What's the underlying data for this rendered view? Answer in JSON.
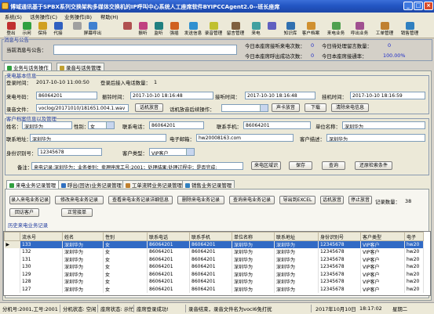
{
  "window": {
    "title": "博域通讯基于SPBX系列交换架构多媒体交换机的IP呼叫中心系统人工座席软件BYIPCCAgent2.0--班长座席",
    "min": "_",
    "max": "□",
    "close": "×"
  },
  "menu": [
    "系统(S)",
    "话务操作(C)",
    "业务操作(B)",
    "帮助(H)"
  ],
  "toolbar": [
    "登出",
    "示闲",
    "保持",
    "代接",
    "",
    "屏幕呼出",
    "",
    "振听",
    "监听",
    "强插",
    "发送信息",
    "录音管理",
    "留言管理",
    "来电",
    "",
    "知识库",
    "客户档案",
    "来电业务",
    "呼出业务",
    "工单管理",
    "销售管理"
  ],
  "notice": {
    "group_title": "消息与公告",
    "label": "当前消息与公告：",
    "stats": [
      {
        "label": "今日本座席接听来电次数：",
        "value": "0"
      },
      {
        "label": "今日本座席呼出成功次数：",
        "value": "0"
      },
      {
        "label": "今日待处理留言数量：",
        "value": "0"
      },
      {
        "label": "今日本座席接通率：",
        "value": "100.00%"
      }
    ]
  },
  "main_tabs": [
    "业务与话务操作",
    "录音与话务管理"
  ],
  "call_info": {
    "group_title": "来电基本信息",
    "login_time_label": "登录时间：",
    "login_time": "2017-10-10 11:00:50",
    "count_label": "登录后接入电话数量：",
    "count": "1",
    "caller_label": "来电号码：",
    "caller": "86064201",
    "ring_time_label": "振铃时间：",
    "ring_time": "2017-10-10 18:16:48",
    "answer_time_label": "接听时间：",
    "answer_time": "2017-10-10 18:16:48",
    "hangup_time_label": "挂机时间：",
    "hangup_time": "2017-10-10 18:16:59",
    "recfile_label": "录音文件：",
    "recfile": "voclog/20171010/181651.004.1.wav",
    "play_btn": "话机放音",
    "after_label": "话机放音后续操作：",
    "after_value": "",
    "sound_btn": "声卡放音",
    "download_btn": "下载",
    "clear_btn": "清除来电信息"
  },
  "customer": {
    "group_title": "客户档案信息以及管理",
    "name_label": "姓名：",
    "name": "深圳华为",
    "sex_label": "性别：",
    "sex": "女",
    "tel_label": "联系电话：",
    "tel": "86064201",
    "mobile_label": "联系手机：",
    "mobile": "86064201",
    "company_label": "单位名称：",
    "company": "深圳华为",
    "addr_label": "联系地址：",
    "addr": "深圳华为",
    "email_label": "电子邮箱：",
    "email": "hw20008163.com",
    "desc_label": "客户描述：",
    "desc": "深圳华为",
    "id_label": "身份识别号：",
    "id": "12345678",
    "type_label": "客户类型：",
    "type": "VIP客户",
    "note_label": "备注：",
    "note": "来电记录:深圳华为；业务类别：卖理座席工号:2001；处理结果:处理过程中；是否完成:",
    "btns": [
      "来电区域识",
      "保存",
      "查询",
      "还原检索条件"
    ]
  },
  "biz_tabs": [
    "来电业务记录管理",
    "呼出(回访)业务记录管理",
    "工单流转业务记录管理",
    "销售业务记录管理"
  ],
  "biz_buttons": [
    "录入来电业务记录",
    "修改来电业务记录",
    "查看来电业务记录详细信息",
    "删除来电业务记录",
    "查询来电业务记录",
    "导出到EXCEL",
    "话机放音",
    "停止放音"
  ],
  "biz_buttons2": [
    "回访客户",
    "正常接单"
  ],
  "record_count_label": "记录数量：",
  "record_count": "38",
  "history_title": "历史来电业务记录",
  "table": {
    "headers": [
      "流水号",
      "姓名",
      "性别",
      "联系电话",
      "联系手机",
      "单位名称",
      "联系地址",
      "身份识别号",
      "客户类型",
      "电子"
    ],
    "rows": [
      [
        "133",
        "深圳华为",
        "女",
        "86064201",
        "86064201",
        "深圳华为",
        "深圳华为",
        "12345678",
        "VIP客户",
        "hw20"
      ],
      [
        "132",
        "深圳华为",
        "女",
        "86064201",
        "86064201",
        "深圳华为",
        "深圳华为",
        "12345678",
        "VIP客户",
        "hw20"
      ],
      [
        "131",
        "深圳华为",
        "女",
        "86064201",
        "86064201",
        "深圳华为",
        "深圳华为",
        "12345678",
        "VIP客户",
        "hw20"
      ],
      [
        "130",
        "深圳华为",
        "女",
        "86064201",
        "86064201",
        "深圳华为",
        "深圳华为",
        "12345678",
        "VIP客户",
        "hw20"
      ],
      [
        "129",
        "深圳华为",
        "女",
        "86064201",
        "86064201",
        "深圳华为",
        "深圳华为",
        "12345678",
        "VIP客户",
        "hw20"
      ],
      [
        "128",
        "深圳华为",
        "女",
        "86064201",
        "86064201",
        "深圳华为",
        "深圳华为",
        "12345678",
        "VIP客户",
        "hw20"
      ],
      [
        "127",
        "深圳华为",
        "女",
        "86064201",
        "86064201",
        "深圳华为",
        "深圳华为",
        "12345678",
        "VIP客户",
        "hw20"
      ]
    ]
  },
  "status": [
    "分机号:2001,工号:2001",
    "分机状态: 空闲",
    "座席状态: 示忙",
    "座席登录成功!",
    "录音结束，录音文件名为vocl6免打扰",
    "2017年10月10日",
    "18:17:02",
    "星期二"
  ]
}
